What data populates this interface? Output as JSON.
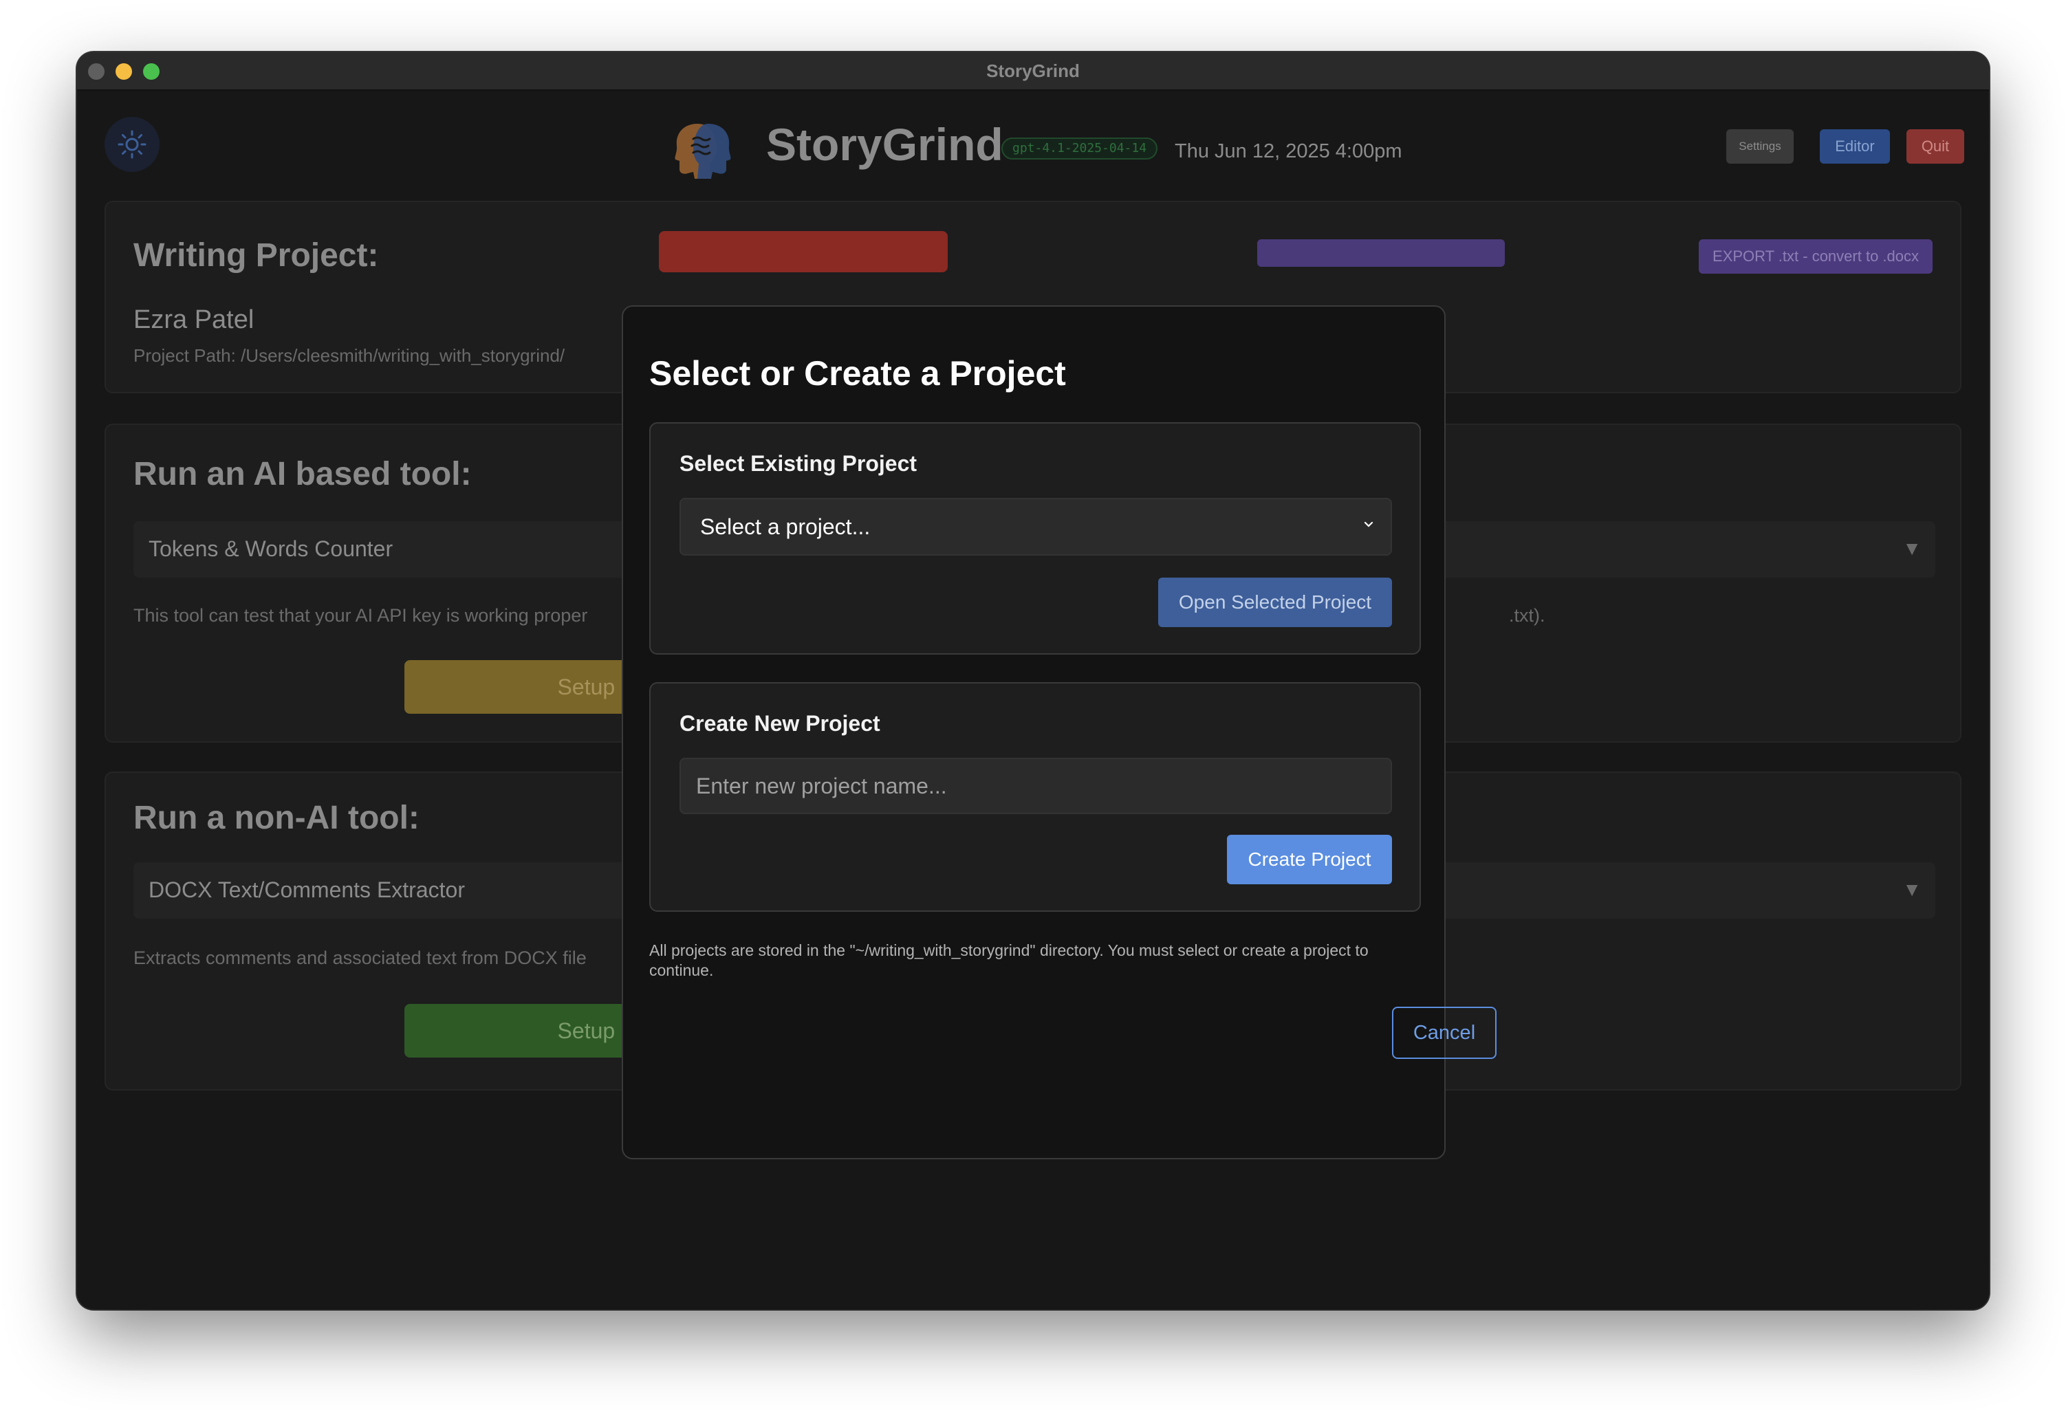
{
  "window": {
    "title": "StoryGrind"
  },
  "header": {
    "app_name": "StoryGrind",
    "model_badge": "gpt-4.1-2025-04-14",
    "datetime": "Thu Jun 12, 2025 4:00pm",
    "settings_label": "Settings",
    "editor_label": "Editor",
    "quit_label": "Quit"
  },
  "project_panel": {
    "title": "Writing Project:",
    "project_name": "Ezra Patel",
    "project_path": "Project Path: /Users/cleesmith/writing_with_storygrind/",
    "export_label": "EXPORT .txt - convert to .docx"
  },
  "ai_tool_panel": {
    "title": "Run an AI based tool:",
    "selected_tool": "Tokens & Words Counter",
    "description": "This tool can test that your AI API key is working proper",
    "description_tail": ".txt).",
    "run_label": "Setup & Run"
  },
  "non_ai_tool_panel": {
    "title": "Run a non-AI tool:",
    "selected_tool": "DOCX Text/Comments Extractor",
    "description": "Extracts comments and associated text from DOCX file",
    "run_label": "Setup & Run"
  },
  "modal": {
    "title": "Select or Create a Project",
    "existing": {
      "heading": "Select Existing Project",
      "select_value": "Select a project...",
      "open_label": "Open Selected Project"
    },
    "create": {
      "heading": "Create New Project",
      "placeholder": "Enter new project name...",
      "create_label": "Create Project"
    },
    "note": "All projects are stored in the \"~/writing_with_storygrind\" directory. You must select or create a project to continue.",
    "cancel_label": "Cancel"
  },
  "colors": {
    "accent_blue": "#5b8ee0",
    "quit_red": "#8a3432",
    "export_purple": "#4c3a7e",
    "run_yellow": "#7a6628",
    "run_green": "#2e5a26"
  },
  "icons": {
    "theme_toggle": "sun-icon",
    "logo": "storygrind-heads-logo",
    "select_chevron": "chevron-down-icon",
    "tool_dropdown": "triangle-down-icon"
  }
}
